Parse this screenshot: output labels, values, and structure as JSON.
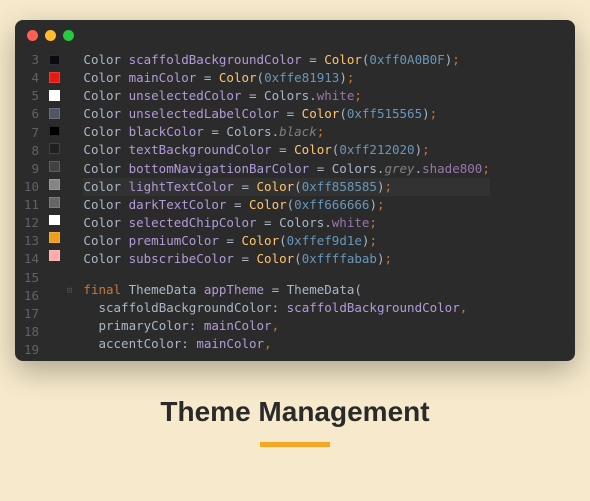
{
  "heading": "Theme Management",
  "lines": [
    {
      "n": 3,
      "sw": "#0A0B0F",
      "tokens": [
        {
          "c": "tk-type",
          "t": "Color "
        },
        {
          "c": "tk-var",
          "t": "scaffoldBackgroundColor"
        },
        {
          "c": "tk-eq",
          "t": " = "
        },
        {
          "c": "tk-class",
          "t": "Color"
        },
        {
          "c": "tk-paren",
          "t": "("
        },
        {
          "c": "tk-hex",
          "t": "0xff0A0B0F"
        },
        {
          "c": "tk-paren",
          "t": ")"
        },
        {
          "c": "tk-punc",
          "t": ";"
        }
      ]
    },
    {
      "n": 4,
      "sw": "#e81913",
      "tokens": [
        {
          "c": "tk-type",
          "t": "Color "
        },
        {
          "c": "tk-var",
          "t": "mainColor"
        },
        {
          "c": "tk-eq",
          "t": " = "
        },
        {
          "c": "tk-class",
          "t": "Color"
        },
        {
          "c": "tk-paren",
          "t": "("
        },
        {
          "c": "tk-hex",
          "t": "0xffe81913"
        },
        {
          "c": "tk-paren",
          "t": ")"
        },
        {
          "c": "tk-punc",
          "t": ";"
        }
      ]
    },
    {
      "n": 5,
      "sw": "#ffffff",
      "tokens": [
        {
          "c": "tk-type",
          "t": "Color "
        },
        {
          "c": "tk-var",
          "t": "unselectedColor"
        },
        {
          "c": "tk-eq",
          "t": " = Colors."
        },
        {
          "c": "tk-prop",
          "t": "white"
        },
        {
          "c": "tk-punc",
          "t": ";"
        }
      ]
    },
    {
      "n": 6,
      "sw": "#515565",
      "tokens": [
        {
          "c": "tk-type",
          "t": "Color "
        },
        {
          "c": "tk-var",
          "t": "unselectedLabelColor"
        },
        {
          "c": "tk-eq",
          "t": " = "
        },
        {
          "c": "tk-class",
          "t": "Color"
        },
        {
          "c": "tk-paren",
          "t": "("
        },
        {
          "c": "tk-hex",
          "t": "0xff515565"
        },
        {
          "c": "tk-paren",
          "t": ")"
        },
        {
          "c": "tk-punc",
          "t": ";"
        }
      ]
    },
    {
      "n": 7,
      "sw": "#000000",
      "tokens": [
        {
          "c": "tk-type",
          "t": "Color "
        },
        {
          "c": "tk-var",
          "t": "blackColor"
        },
        {
          "c": "tk-eq",
          "t": " = Colors."
        },
        {
          "c": "tk-ital",
          "t": "black"
        },
        {
          "c": "tk-punc",
          "t": ";"
        }
      ]
    },
    {
      "n": 8,
      "sw": "#212020",
      "tokens": [
        {
          "c": "tk-type",
          "t": "Color "
        },
        {
          "c": "tk-var",
          "t": "textBackgroundColor"
        },
        {
          "c": "tk-eq",
          "t": " = "
        },
        {
          "c": "tk-class",
          "t": "Color"
        },
        {
          "c": "tk-paren",
          "t": "("
        },
        {
          "c": "tk-hex",
          "t": "0xff212020"
        },
        {
          "c": "tk-paren",
          "t": ")"
        },
        {
          "c": "tk-punc",
          "t": ";"
        }
      ]
    },
    {
      "n": 9,
      "sw": "#424242",
      "tokens": [
        {
          "c": "tk-type",
          "t": "Color "
        },
        {
          "c": "tk-var",
          "t": "bottomNavigationBarColor"
        },
        {
          "c": "tk-eq",
          "t": " = Colors."
        },
        {
          "c": "tk-ital",
          "t": "grey"
        },
        {
          "c": "tk-eq",
          "t": "."
        },
        {
          "c": "tk-prop",
          "t": "shade800"
        },
        {
          "c": "tk-punc",
          "t": ";"
        }
      ]
    },
    {
      "n": 10,
      "sw": "#858585",
      "hl": true,
      "tokens": [
        {
          "c": "tk-type",
          "t": "Color "
        },
        {
          "c": "tk-var",
          "t": "lightTextColor"
        },
        {
          "c": "tk-eq",
          "t": " = "
        },
        {
          "c": "tk-class",
          "t": "Color"
        },
        {
          "c": "tk-paren",
          "t": "("
        },
        {
          "c": "tk-hex",
          "t": "0xff858585"
        },
        {
          "c": "tk-paren",
          "t": ")"
        },
        {
          "c": "tk-punc",
          "t": ";"
        }
      ]
    },
    {
      "n": 11,
      "sw": "#666666",
      "tokens": [
        {
          "c": "tk-type",
          "t": "Color "
        },
        {
          "c": "tk-var",
          "t": "darkTextColor"
        },
        {
          "c": "tk-eq",
          "t": " = "
        },
        {
          "c": "tk-class",
          "t": "Color"
        },
        {
          "c": "tk-paren",
          "t": "("
        },
        {
          "c": "tk-hex",
          "t": "0xff666666"
        },
        {
          "c": "tk-paren",
          "t": ")"
        },
        {
          "c": "tk-punc",
          "t": ";"
        }
      ]
    },
    {
      "n": 12,
      "sw": "#ffffff",
      "tokens": [
        {
          "c": "tk-type",
          "t": "Color "
        },
        {
          "c": "tk-var",
          "t": "selectedChipColor"
        },
        {
          "c": "tk-eq",
          "t": " = Colors."
        },
        {
          "c": "tk-prop",
          "t": "white"
        },
        {
          "c": "tk-punc",
          "t": ";"
        }
      ]
    },
    {
      "n": 13,
      "sw": "#ef9d1e",
      "tokens": [
        {
          "c": "tk-type",
          "t": "Color "
        },
        {
          "c": "tk-var",
          "t": "premiumColor"
        },
        {
          "c": "tk-eq",
          "t": " = "
        },
        {
          "c": "tk-class",
          "t": "Color"
        },
        {
          "c": "tk-paren",
          "t": "("
        },
        {
          "c": "tk-hex",
          "t": "0xffef9d1e"
        },
        {
          "c": "tk-paren",
          "t": ")"
        },
        {
          "c": "tk-punc",
          "t": ";"
        }
      ]
    },
    {
      "n": 14,
      "sw": "#ffabab",
      "tokens": [
        {
          "c": "tk-type",
          "t": "Color "
        },
        {
          "c": "tk-var",
          "t": "subscribeColor"
        },
        {
          "c": "tk-eq",
          "t": " = "
        },
        {
          "c": "tk-class",
          "t": "Color"
        },
        {
          "c": "tk-paren",
          "t": "("
        },
        {
          "c": "tk-hex",
          "t": "0xffffabab"
        },
        {
          "c": "tk-paren",
          "t": ")"
        },
        {
          "c": "tk-punc",
          "t": ";"
        }
      ]
    },
    {
      "n": 15,
      "tokens": [
        {
          "c": "tk-eq",
          "t": ""
        }
      ]
    },
    {
      "n": 16,
      "fold": "⊟",
      "tokens": [
        {
          "c": "tk-kw",
          "t": "final "
        },
        {
          "c": "tk-type",
          "t": "ThemeData "
        },
        {
          "c": "tk-var",
          "t": "appTheme"
        },
        {
          "c": "tk-eq",
          "t": " = ThemeData("
        }
      ]
    },
    {
      "n": 17,
      "tokens": [
        {
          "c": "tk-eq",
          "t": "  "
        },
        {
          "c": "tk-param",
          "t": "scaffoldBackgroundColor: "
        },
        {
          "c": "tk-var",
          "t": "scaffoldBackgroundColor"
        },
        {
          "c": "tk-punc",
          "t": ","
        }
      ]
    },
    {
      "n": 18,
      "tokens": [
        {
          "c": "tk-eq",
          "t": "  "
        },
        {
          "c": "tk-param",
          "t": "primaryColor: "
        },
        {
          "c": "tk-var",
          "t": "mainColor"
        },
        {
          "c": "tk-punc",
          "t": ","
        }
      ]
    },
    {
      "n": 19,
      "tokens": [
        {
          "c": "tk-eq",
          "t": "  "
        },
        {
          "c": "tk-param",
          "t": "accentColor: "
        },
        {
          "c": "tk-var",
          "t": "mainColor"
        },
        {
          "c": "tk-punc",
          "t": ","
        }
      ]
    }
  ]
}
